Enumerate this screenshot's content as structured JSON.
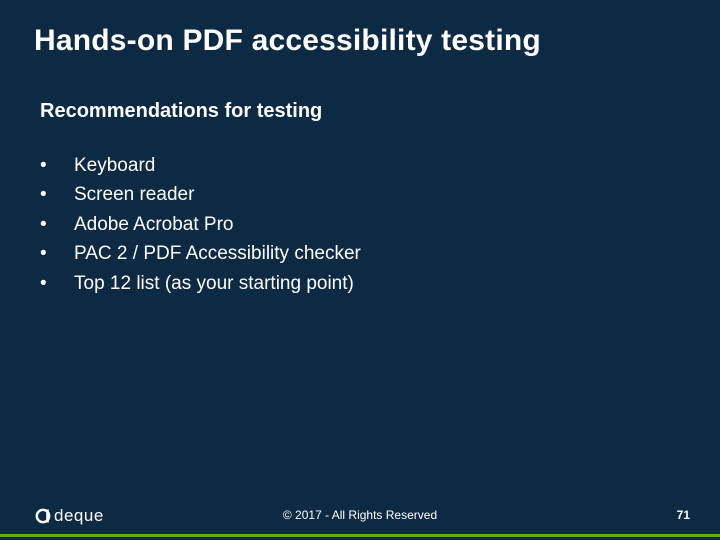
{
  "slide": {
    "title": "Hands-on PDF accessibility testing",
    "subtitle": "Recommendations for testing",
    "bullets": [
      "Keyboard",
      "Screen reader",
      "Adobe Acrobat Pro",
      "PAC 2 / PDF Accessibility checker",
      "Top 12 list (as your starting point)"
    ],
    "footer": {
      "logo_text": "deque",
      "copyright": "© 2017 - All Rights Reserved",
      "page_number": "71"
    },
    "colors": {
      "background": "#0d2a44",
      "accent": "#6aa52e",
      "text": "#ffffff"
    }
  }
}
